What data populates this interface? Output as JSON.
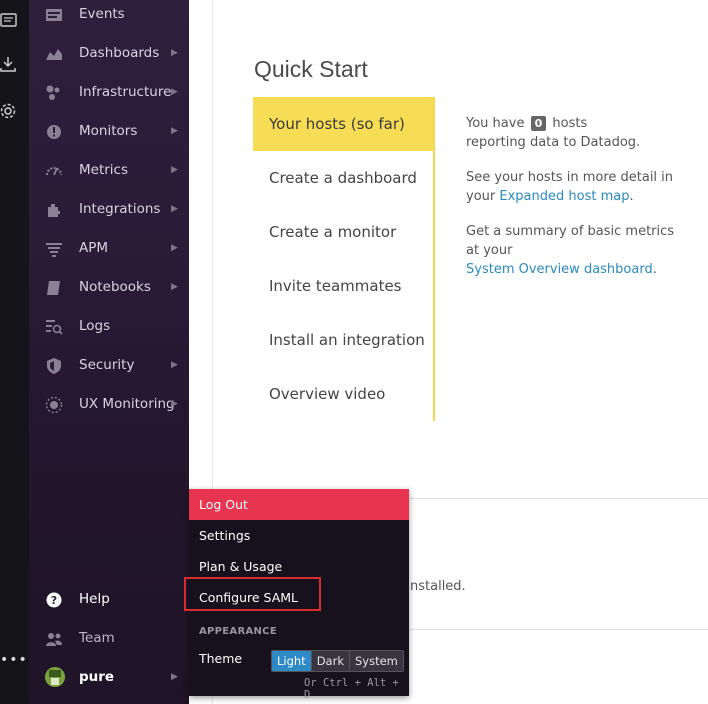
{
  "nav": {
    "items": [
      {
        "label": "Events",
        "icon": "events-icon",
        "chevron": false
      },
      {
        "label": "Dashboards",
        "icon": "dashboards-icon",
        "chevron": true
      },
      {
        "label": "Infrastructure",
        "icon": "infrastructure-icon",
        "chevron": true
      },
      {
        "label": "Monitors",
        "icon": "monitors-icon",
        "chevron": true
      },
      {
        "label": "Metrics",
        "icon": "metrics-icon",
        "chevron": true
      },
      {
        "label": "Integrations",
        "icon": "integrations-icon",
        "chevron": true
      },
      {
        "label": "APM",
        "icon": "apm-icon",
        "chevron": true
      },
      {
        "label": "Notebooks",
        "icon": "notebooks-icon",
        "chevron": true
      },
      {
        "label": "Logs",
        "icon": "logs-icon",
        "chevron": false
      },
      {
        "label": "Security",
        "icon": "security-icon",
        "chevron": true
      },
      {
        "label": "UX Monitoring",
        "icon": "ux-monitoring-icon",
        "chevron": true
      }
    ],
    "chevron_glyph": "▶",
    "bottom": {
      "help": "Help",
      "team": "Team",
      "user": "pure"
    }
  },
  "rail": {
    "more": "•••"
  },
  "quick_start": {
    "title": "Quick Start",
    "tabs": [
      "Your hosts (so far)",
      "Create a dashboard",
      "Create a monitor",
      "Invite teammates",
      "Install an integration",
      "Overview video"
    ],
    "para1_pre": "You have",
    "host_count": "0",
    "para1_post": "hosts reporting data to Datadog.",
    "para2_pre": "See your hosts in more detail in your",
    "para2_link": "Expanded host map",
    "para2_post": ".",
    "para3_pre": "Get a summary of basic metrics at your",
    "para3_link": "System Overview dashboard",
    "para3_post": ".",
    "installed_text": "nstalled."
  },
  "user_menu": {
    "logout": "Log Out",
    "settings": "Settings",
    "plan": "Plan & Usage",
    "saml": "Configure SAML",
    "appearance": "APPEARANCE",
    "theme_label": "Theme",
    "theme_options": [
      "Light",
      "Dark",
      "System"
    ],
    "theme_selected": "Light",
    "shortcut": "Or Ctrl + Alt + D"
  },
  "colors": {
    "accent_yellow": "#f7dc55",
    "logout_red": "#e8354f",
    "highlight_box": "#d92d2d",
    "link_blue": "#2a8ac2"
  }
}
